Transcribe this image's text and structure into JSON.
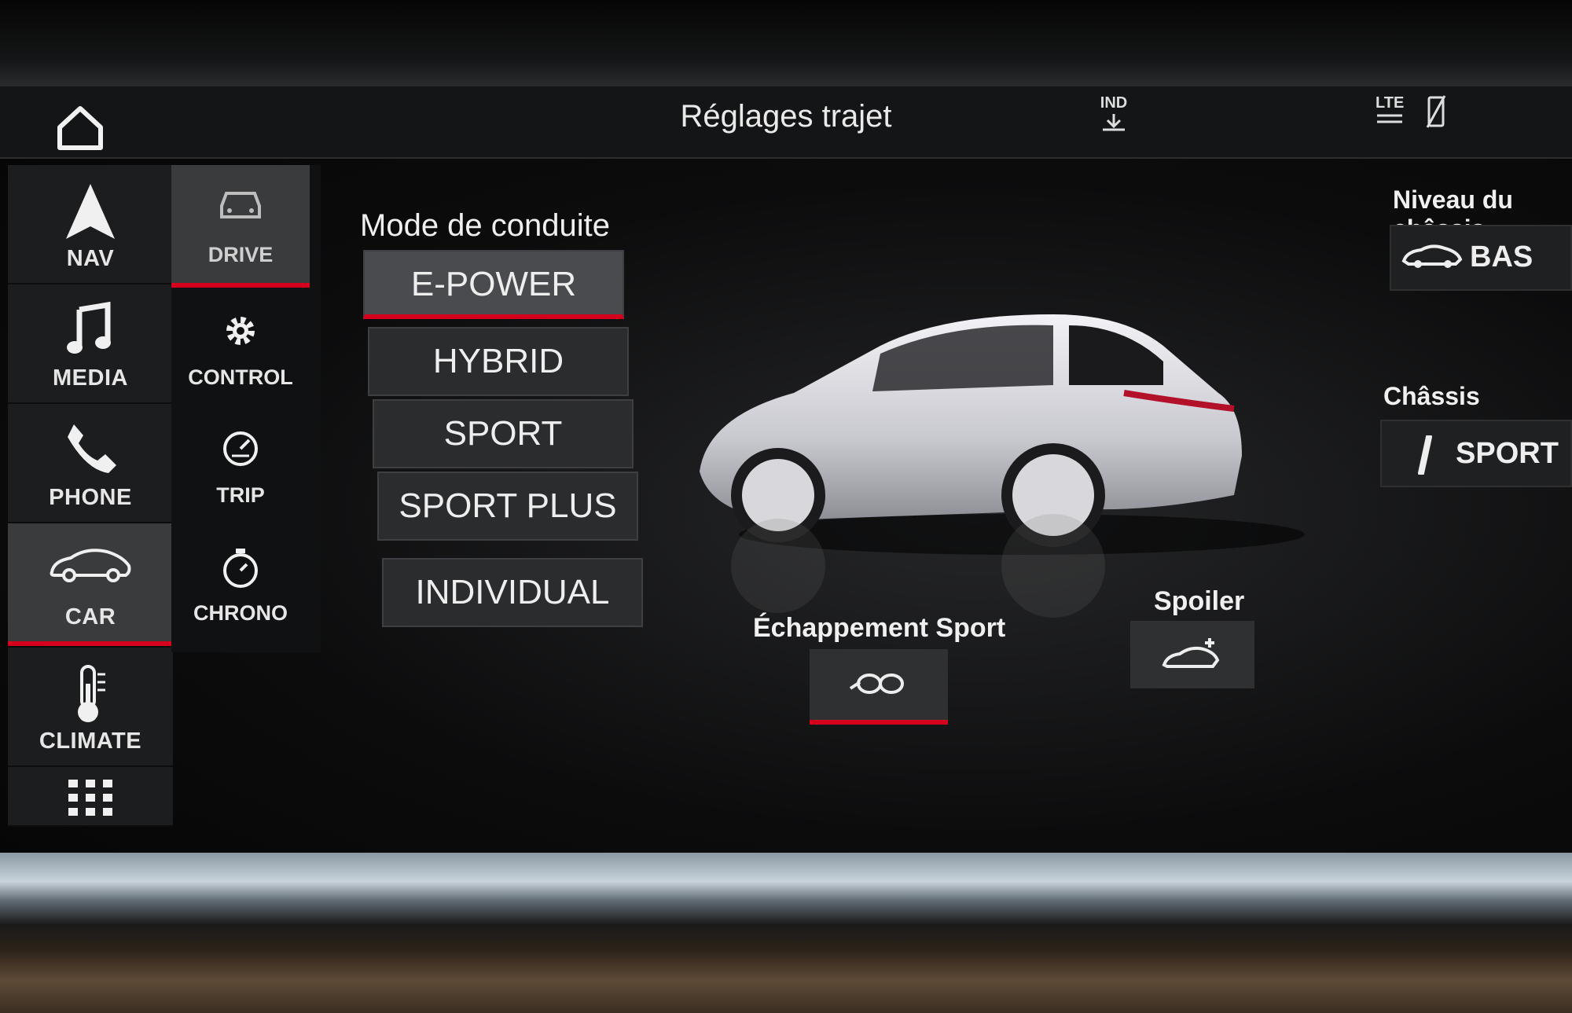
{
  "header": {
    "title": "Réglages trajet",
    "ind_label": "IND",
    "lte_label": "LTE"
  },
  "nav": {
    "items": [
      {
        "label": "NAV",
        "icon": "navigation-arrow-icon"
      },
      {
        "label": "MEDIA",
        "icon": "music-note-icon"
      },
      {
        "label": "PHONE",
        "icon": "phone-handset-icon"
      },
      {
        "label": "CAR",
        "icon": "car-icon",
        "active": true
      },
      {
        "label": "CLIMATE",
        "icon": "thermometer-icon"
      },
      {
        "label": "",
        "icon": "apps-grid-icon"
      }
    ]
  },
  "subnav": {
    "items": [
      {
        "label": "DRIVE",
        "icon": "car-front-icon",
        "active": true
      },
      {
        "label": "CONTROL",
        "icon": "gear-icon"
      },
      {
        "label": "TRIP",
        "icon": "gauge-icon"
      },
      {
        "label": "CHRONO",
        "icon": "stopwatch-icon"
      }
    ]
  },
  "drive_modes": {
    "title": "Mode de conduite",
    "options": [
      "E-POWER",
      "HYBRID",
      "SPORT",
      "SPORT PLUS",
      "INDIVIDUAL"
    ],
    "selected": "E-POWER"
  },
  "chassis_level": {
    "label": "Niveau du châssis",
    "value": "BAS"
  },
  "chassis": {
    "label": "Châssis",
    "value": "SPORT"
  },
  "sport_exhaust": {
    "label": "Échappement Sport",
    "active": true
  },
  "spoiler": {
    "label": "Spoiler"
  },
  "colors": {
    "accent": "#d5001c",
    "background": "#0c0c0d",
    "tile": "#2b2c2e"
  }
}
